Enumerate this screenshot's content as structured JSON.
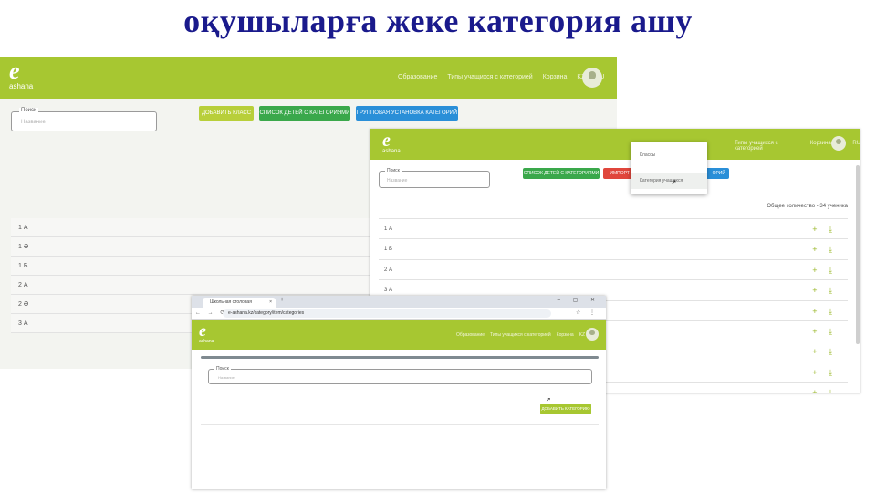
{
  "slide": {
    "title": "оқушыларға жеке категория ашу"
  },
  "colors": {
    "header_green": "#a7c731",
    "button_yellowgreen": "#b8cf3a",
    "button_green": "#3aa84b",
    "button_red": "#e0463c",
    "button_blue": "#2a8fd8",
    "title_blue": "#1a1a8c"
  },
  "app": {
    "logo_mark": "e",
    "logo_text": "ashana"
  },
  "shot1": {
    "nav": [
      "Образование",
      "Типы учащихся с категорией",
      "Корзина",
      "KZ",
      "RU"
    ],
    "search_label": "Поиск",
    "search_placeholder": "Название",
    "buttons": [
      "ДОБАВИТЬ КЛАСС",
      "СПИСОК ДЕТЕЙ С КАТЕГОРИЯМИ",
      "ГРУППОВАЯ УСТАНОВКА КАТЕГОРИЙ"
    ],
    "rows": [
      "1 А",
      "1 Ә",
      "1 Б",
      "2 А",
      "2 Ә",
      "3 А"
    ]
  },
  "shot2": {
    "nav": [
      "Типы учащихся с категорией",
      "Корзина",
      "KZ",
      "RU"
    ],
    "search_label": "Поиск",
    "search_placeholder": "Название",
    "buttons": [
      "СПИСОК ДЕТЕЙ С КАТЕГОРИЯМИ",
      "ИМПОРТ УЧ",
      "ОРИЙ"
    ],
    "dropdown": [
      "Классы",
      "Категория учащихся"
    ],
    "total": "Общее количество - 34 ученика",
    "rows": [
      "1 А",
      "1 Б",
      "2 А",
      "3 А",
      "",
      "",
      "",
      "",
      ""
    ],
    "row_actions": "+ ⤓"
  },
  "shot3": {
    "tab_title": "Школьная столовая",
    "url": "e-ashana.kz/category/item/categories",
    "nav": [
      "Образование",
      "Типы учащихся с категорией",
      "Корзина",
      "KZ",
      "RU"
    ],
    "search_label": "Поиск",
    "search_placeholder": "Название",
    "add_button": "ДОБАВИТЬ КАТЕГОРИЮ"
  }
}
